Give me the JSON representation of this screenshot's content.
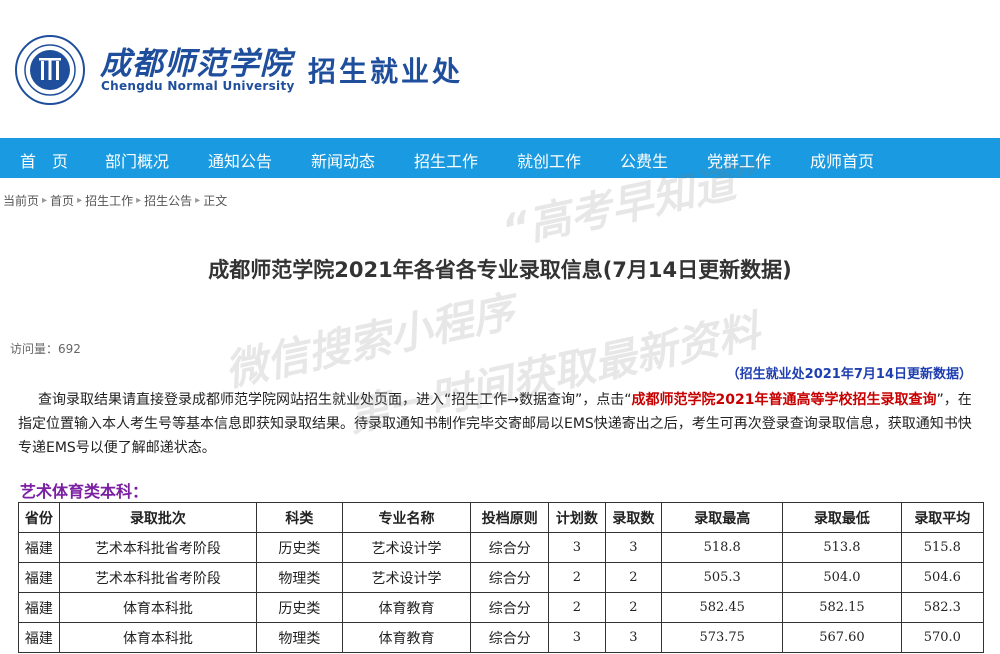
{
  "header": {
    "logo_cn": "成都师范学院",
    "logo_en": "Chengdu Normal University",
    "dept": "招生就业处"
  },
  "nav": [
    "首　页",
    "部门概况",
    "通知公告",
    "新闻动态",
    "招生工作",
    "就创工作",
    "公费生",
    "党群工作",
    "成师首页"
  ],
  "breadcrumb": [
    "当前页",
    "首页",
    "招生工作",
    "招生公告",
    "正文"
  ],
  "watermark": [
    "“高考早知道”",
    "微信搜索小程序",
    "第一时间获取最新资料"
  ],
  "title": "成都师范学院2021年各省各专业录取信息(7月14日更新数据)",
  "visits": "访问量：692",
  "update_note": "（招生就业处2021年7月14日更新数据）",
  "para": {
    "p1": "查询录取结果请直接登录成都师范学院网站招生就业处页面，进入“招生工作→数据查询”，点击“",
    "highlight": "成都师范学院2021年普通高等学校招生录取查询",
    "p2": "”，在指定位置输入本人考生号等基本信息即获知录取结果。待录取通知书制作完毕交寄邮局以EMS快递寄出之后，考生可再次登录查询录取信息，获取通知书快专递EMS号以便了解邮递状态。"
  },
  "section_title": "艺术体育类本科：",
  "table": {
    "headers": [
      "省份",
      "录取批次",
      "科类",
      "专业名称",
      "投档原则",
      "计划数",
      "录取数",
      "录取最高",
      "录取最低",
      "录取平均"
    ],
    "rows": [
      [
        "福建",
        "艺术本科批省考阶段",
        "历史类",
        "艺术设计学",
        "综合分",
        "3",
        "3",
        "518.8",
        "513.8",
        "515.8"
      ],
      [
        "福建",
        "艺术本科批省考阶段",
        "物理类",
        "艺术设计学",
        "综合分",
        "2",
        "2",
        "505.3",
        "504.0",
        "504.6"
      ],
      [
        "福建",
        "体育本科批",
        "历史类",
        "体育教育",
        "综合分",
        "2",
        "2",
        "582.45",
        "582.15",
        "582.3"
      ],
      [
        "福建",
        "体育本科批",
        "物理类",
        "体育教育",
        "综合分",
        "3",
        "3",
        "573.75",
        "567.60",
        "570.0"
      ]
    ]
  }
}
